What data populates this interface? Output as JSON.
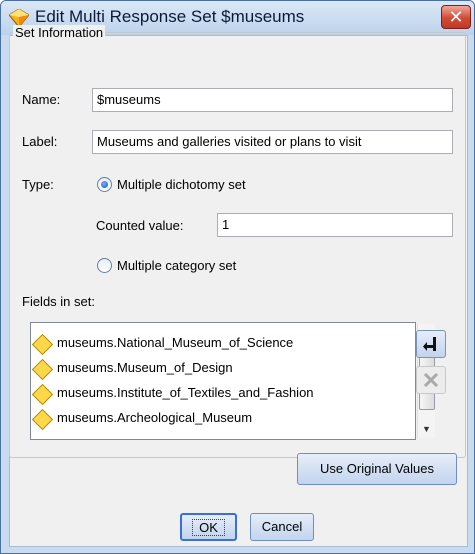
{
  "window": {
    "title": "Edit Multi Response Set $museums",
    "close_glyph": "✕"
  },
  "set_info": {
    "legend": "Set Information",
    "name_label": "Name:",
    "name_value": "$museums",
    "label_label": "Label:",
    "label_value": "Museums and galleries visited or plans to visit",
    "type_label": "Type:",
    "dichotomy_option": "Multiple dichotomy set",
    "dichotomy_selected": true,
    "counted_label": "Counted value:",
    "counted_value": "1",
    "category_option": "Multiple category set",
    "fields_label": "Fields in set:",
    "fields": [
      "museums.National_Museum_of_Science",
      "museums.Museum_of_Design",
      "museums.Institute_of_Textiles_and_Fashion",
      "museums.Archeological_Museum"
    ],
    "use_original_label": "Use Original Values"
  },
  "footer": {
    "ok_label": "OK",
    "cancel_label": "Cancel"
  },
  "colors": {
    "accent": "#3b6fd8",
    "title_bar": "#c9dbef",
    "close": "#d24a34"
  },
  "icons": {
    "title": "app-diamond-icon",
    "field": "field-diamond-icon",
    "add": "add-field-icon",
    "remove": "remove-x-icon"
  }
}
